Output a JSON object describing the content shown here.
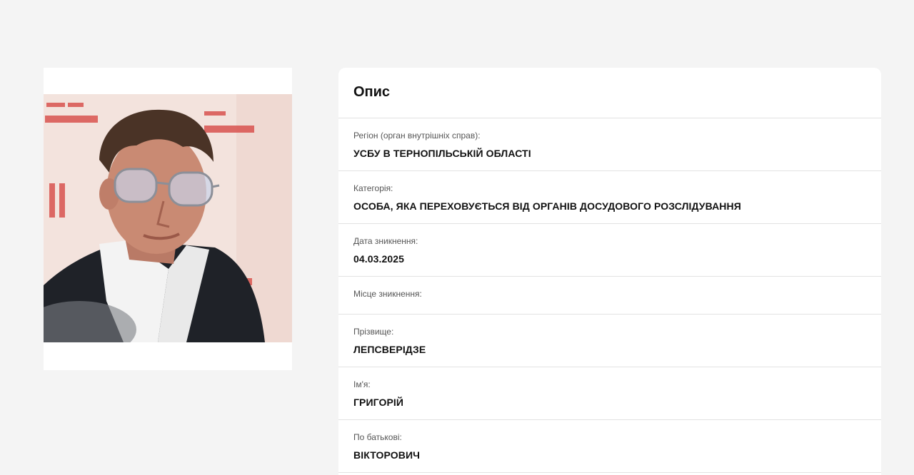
{
  "photo": {
    "alt": "Фото особи",
    "colors": {
      "backdrop": "#f3e3dd",
      "backdrop_red": "#d9534f",
      "jacket": "#1f2228",
      "shirt": "#f3f3f3",
      "skin": "#c98a73",
      "hair": "#4a3326"
    }
  },
  "description": {
    "title": "Опис",
    "fields": [
      {
        "label": "Регіон (орган внутрішніх справ):",
        "value": "УСБУ В ТЕРНОПІЛЬСЬКІЙ ОБЛАСТІ"
      },
      {
        "label": "Категорія:",
        "value": "ОСОБА, ЯКА ПЕРЕХОВУЄТЬСЯ ВІД ОРГАНІВ ДОСУДОВОГО РОЗСЛІДУВАННЯ"
      },
      {
        "label": "Дата зникнення:",
        "value": "04.03.2025"
      },
      {
        "label": "Місце зникнення:",
        "value": ""
      },
      {
        "label": "Прізвище:",
        "value": "ЛЕПСВЕРІДЗЕ"
      },
      {
        "label": "Ім'я:",
        "value": "ГРИГОРІЙ"
      },
      {
        "label": "По батькові:",
        "value": "ВІКТОРОВИЧ"
      }
    ]
  }
}
